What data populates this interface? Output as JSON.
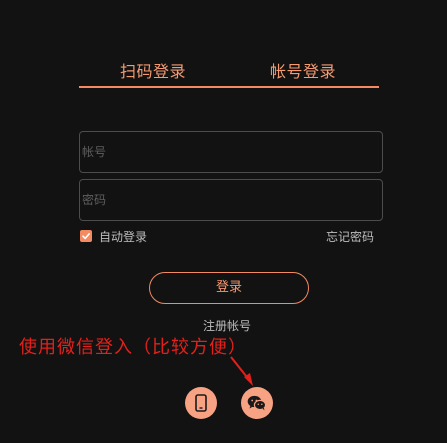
{
  "tabs": {
    "qr": "扫码登录",
    "account": "帐号登录"
  },
  "form": {
    "account_placeholder": "帐号",
    "password_placeholder": "密码",
    "auto_login_label": "自动登录",
    "forgot_label": "忘记密码",
    "login_label": "登录",
    "register_label": "注册帐号",
    "auto_login_checked": true
  },
  "annotation": {
    "text": "使用微信登入（比较方便）",
    "color": "#e3201b"
  },
  "social": {
    "phone_icon": "phone-icon",
    "wechat_icon": "wechat-icon"
  },
  "colors": {
    "accent": "#f38a62",
    "background": "#121212"
  }
}
